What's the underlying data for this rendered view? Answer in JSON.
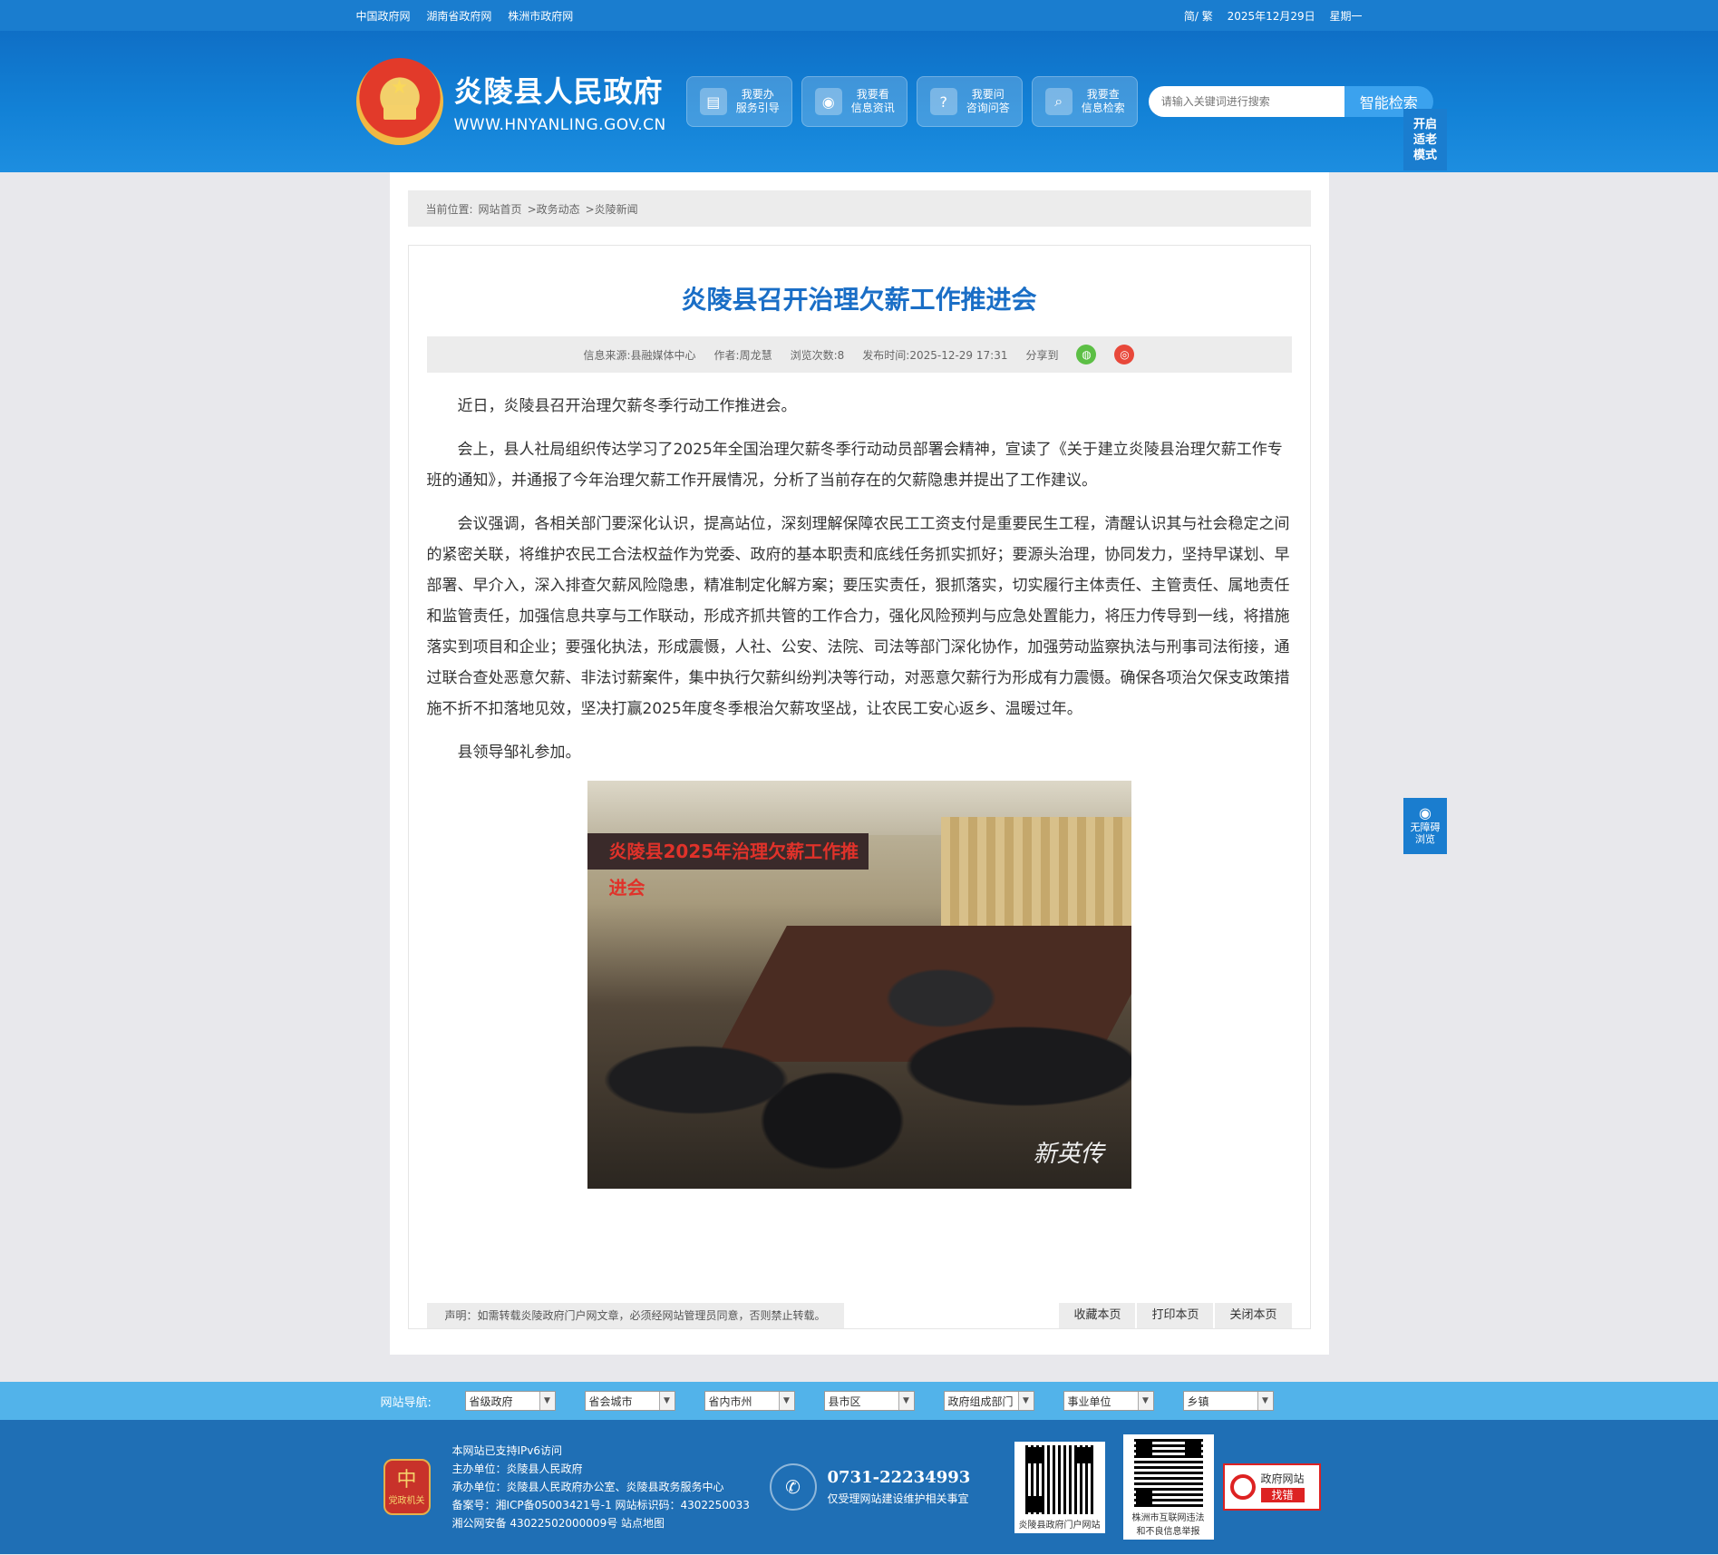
{
  "topbar": {
    "links": [
      "中国政府网",
      "湖南省政府网",
      "株洲市政府网"
    ],
    "lang": "简/ 繁",
    "date": "2025年12月29日",
    "weekday": "星期一"
  },
  "header": {
    "site_name": "炎陵县人民政府",
    "site_url": "WWW.HNYANLING.GOV.CN",
    "quick_links": [
      {
        "line1": "我要办",
        "line2": "服务引导",
        "icon": "doc-icon"
      },
      {
        "line1": "我要看",
        "line2": "信息资讯",
        "icon": "eye-icon"
      },
      {
        "line1": "我要问",
        "line2": "咨询问答",
        "icon": "question-icon"
      },
      {
        "line1": "我要查",
        "line2": "信息检索",
        "icon": "search-icon"
      }
    ],
    "search_placeholder": "请输入关键词进行搜索",
    "search_button": "智能检索",
    "elder_mode": [
      "开启",
      "适老",
      "模式"
    ]
  },
  "breadcrumb": {
    "label": "当前位置:",
    "items": [
      "网站首页",
      ">政务动态",
      ">炎陵新闻"
    ]
  },
  "article": {
    "title": "炎陵县召开治理欠薪工作推进会",
    "meta": {
      "source": "信息来源:县融媒体中心",
      "author": "作者:周龙慧",
      "views": "浏览次数:8",
      "published": "发布时间:2025-12-29 17:31",
      "share": "分享到"
    },
    "paragraphs": [
      "近日，炎陵县召开治理欠薪冬季行动工作推进会。",
      "会上，县人社局组织传达学习了2025年全国治理欠薪冬季行动动员部署会精神，宣读了《关于建立炎陵县治理欠薪工作专班的通知》，并通报了今年治理欠薪工作开展情况，分析了当前存在的欠薪隐患并提出了工作建议。",
      "会议强调，各相关部门要深化认识，提高站位，深刻理解保障农民工工资支付是重要民生工程，清醒认识其与社会稳定之间的紧密关联，将维护农民工合法权益作为党委、政府的基本职责和底线任务抓实抓好；要源头治理，协同发力，坚持早谋划、早部署、早介入，深入排查欠薪风险隐患，精准制定化解方案；要压实责任，狠抓落实，切实履行主体责任、主管责任、属地责任和监管责任，加强信息共享与工作联动，形成齐抓共管的工作合力，强化风险预判与应急处置能力，将压力传导到一线，将措施落实到项目和企业；要强化执法，形成震慑，人社、公安、法院、司法等部门深化协作，加强劳动监察执法与刑事司法衔接，通过联合查处恶意欠薪、非法讨薪案件，集中执行欠薪纠纷判决等行动，对恶意欠薪行为形成有力震慑。确保各项治欠保支政策措施不折不扣落地见效，坚决打赢2025年度冬季根治欠薪攻坚战，让农民工安心返乡、温暖过年。",
      "县领导邹礼参加。"
    ],
    "photo_banner": "炎陵县2025年治理欠薪工作推进会",
    "photo_signature": "新英传",
    "notice": "声明：如需转载炎陵政府门户网文章，必须经网站管理员同意，否则禁止转载。",
    "actions": [
      "收藏本页",
      "打印本页",
      "关闭本页"
    ]
  },
  "a11y": {
    "line1": "无障碍",
    "line2": "浏览"
  },
  "site_nav": {
    "label": "网站导航:",
    "selects": [
      "省级政府",
      "省会城市",
      "省内市州",
      "县市区",
      "政府组成部门",
      "事业单位",
      "乡镇"
    ]
  },
  "footer": {
    "party_badge": "党政机关",
    "lines": [
      "本网站已支持IPv6访问",
      "主办单位：炎陵县人民政府",
      "承办单位：炎陵县人民政府办公室、炎陵县政务服务中心",
      "备案号：湘ICP备05003421号-1 网站标识码：4302250033",
      "湘公网安备 43022502000009号 站点地图"
    ],
    "phone": "0731-22234993",
    "phone_note": "仅受理网站建设维护相关事宜",
    "qr1_caption": "炎陵县政府门户网站",
    "qr2_caption_1": "株洲市互联网违法",
    "qr2_caption_2": "和不良信息举报",
    "jiucuo_1": "政府网站",
    "jiucuo_2": "找错"
  }
}
